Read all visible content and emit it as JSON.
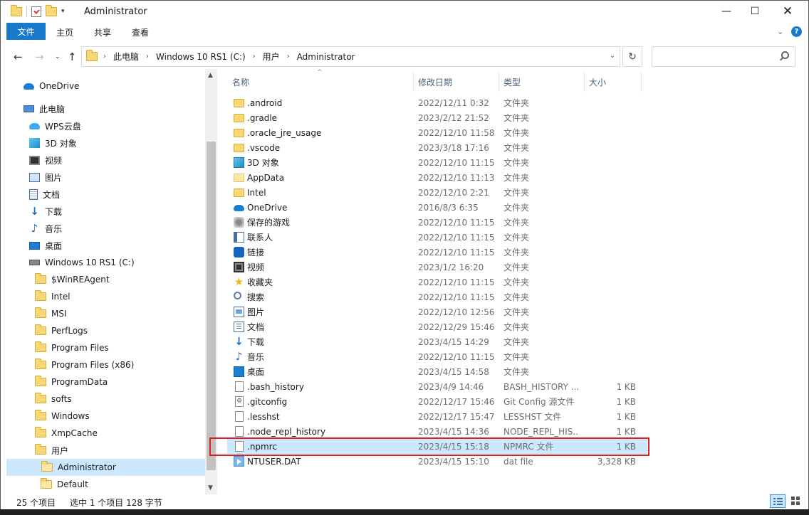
{
  "window": {
    "title": "Administrator"
  },
  "ribbon": {
    "file": "文件",
    "home": "主页",
    "share": "共享",
    "view": "查看",
    "help": "?"
  },
  "address": {
    "crumbs": [
      "此电脑",
      "Windows 10 RS1 (C:)",
      "用户",
      "Administrator"
    ]
  },
  "search": {
    "placeholder": ""
  },
  "nav": {
    "onedrive": "OneDrive",
    "thispc": "此电脑",
    "wps": "WPS云盘",
    "objects3d": "3D 对象",
    "videos": "视频",
    "pictures": "图片",
    "documents": "文档",
    "downloads": "下载",
    "music": "音乐",
    "desktop": "桌面",
    "drive": "Windows 10 RS1 (C:)",
    "folders": [
      "$WinREAgent",
      "Intel",
      "MSI",
      "PerfLogs",
      "Program Files",
      "Program Files (x86)",
      "ProgramData",
      "softs",
      "Windows",
      "XmpCache",
      "用户",
      "Administrator",
      "Default"
    ]
  },
  "columns": {
    "name": "名称",
    "date": "修改日期",
    "type": "类型",
    "size": "大小"
  },
  "files": [
    {
      "name": ".android",
      "date": "2022/12/11 0:32",
      "type": "文件夹",
      "size": "",
      "icon": "folder"
    },
    {
      "name": ".gradle",
      "date": "2023/2/12 21:52",
      "type": "文件夹",
      "size": "",
      "icon": "folder"
    },
    {
      "name": ".oracle_jre_usage",
      "date": "2022/12/10 11:58",
      "type": "文件夹",
      "size": "",
      "icon": "folder"
    },
    {
      "name": ".vscode",
      "date": "2023/3/18 17:16",
      "type": "文件夹",
      "size": "",
      "icon": "folder"
    },
    {
      "name": "3D 对象",
      "date": "2022/12/10 11:15",
      "type": "文件夹",
      "size": "",
      "icon": "cube"
    },
    {
      "name": "AppData",
      "date": "2022/12/10 11:13",
      "type": "文件夹",
      "size": "",
      "icon": "folder-pale"
    },
    {
      "name": "Intel",
      "date": "2022/12/10 2:21",
      "type": "文件夹",
      "size": "",
      "icon": "folder"
    },
    {
      "name": "OneDrive",
      "date": "2016/8/3 6:35",
      "type": "文件夹",
      "size": "",
      "icon": "cloud"
    },
    {
      "name": "保存的游戏",
      "date": "2022/12/10 11:15",
      "type": "文件夹",
      "size": "",
      "icon": "game"
    },
    {
      "name": "联系人",
      "date": "2022/12/10 11:15",
      "type": "文件夹",
      "size": "",
      "icon": "card"
    },
    {
      "name": "链接",
      "date": "2022/12/10 11:15",
      "type": "文件夹",
      "size": "",
      "icon": "link"
    },
    {
      "name": "视频",
      "date": "2023/1/2 16:20",
      "type": "文件夹",
      "size": "",
      "icon": "film"
    },
    {
      "name": "收藏夹",
      "date": "2022/12/10 11:15",
      "type": "文件夹",
      "size": "",
      "icon": "star"
    },
    {
      "name": "搜索",
      "date": "2022/12/10 11:15",
      "type": "文件夹",
      "size": "",
      "icon": "search"
    },
    {
      "name": "图片",
      "date": "2022/12/10 12:56",
      "type": "文件夹",
      "size": "",
      "icon": "pic"
    },
    {
      "name": "文档",
      "date": "2022/12/29 15:46",
      "type": "文件夹",
      "size": "",
      "icon": "doc"
    },
    {
      "name": "下载",
      "date": "2023/4/15 14:29",
      "type": "文件夹",
      "size": "",
      "icon": "down"
    },
    {
      "name": "音乐",
      "date": "2022/12/10 11:15",
      "type": "文件夹",
      "size": "",
      "icon": "music"
    },
    {
      "name": "桌面",
      "date": "2023/4/15 14:58",
      "type": "文件夹",
      "size": "",
      "icon": "desk"
    },
    {
      "name": ".bash_history",
      "date": "2023/4/9 14:46",
      "type": "BASH_HISTORY ...",
      "size": "1 KB",
      "icon": "file"
    },
    {
      "name": ".gitconfig",
      "date": "2022/12/17 15:46",
      "type": "Git Config 源文件",
      "size": "1 KB",
      "icon": "gear"
    },
    {
      "name": ".lesshst",
      "date": "2022/12/17 15:47",
      "type": "LESSHST 文件",
      "size": "1 KB",
      "icon": "file"
    },
    {
      "name": ".node_repl_history",
      "date": "2023/4/15 14:36",
      "type": "NODE_REPL_HIS...",
      "size": "1 KB",
      "icon": "file"
    },
    {
      "name": ".npmrc",
      "date": "2023/4/15 15:18",
      "type": "NPMRC 文件",
      "size": "1 KB",
      "icon": "file",
      "selected": true
    },
    {
      "name": "NTUSER.DAT",
      "date": "2023/4/15 15:10",
      "type": "dat file",
      "size": "3,328 KB",
      "icon": "dat"
    }
  ],
  "status": {
    "count": "25 个项目",
    "selection": "选中 1 个项目  128 字节"
  }
}
